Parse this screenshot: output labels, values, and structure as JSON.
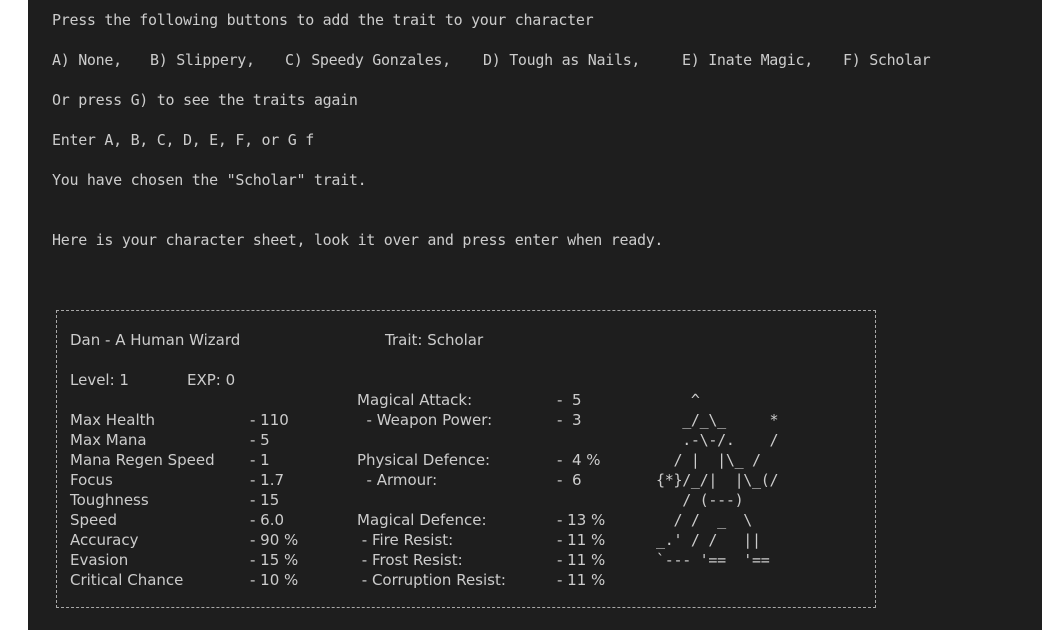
{
  "prompt": {
    "line1": "Press the following buttons to add the trait to your character",
    "options": [
      "A) None,",
      "B) Slippery,",
      "C) Speedy Gonzales,",
      "D) Tough as Nails,",
      "E) Inate Magic,",
      "F) Scholar"
    ],
    "line3": "Or press G) to see the traits again",
    "line4": "Enter A, B, C, D, E, F, or G f",
    "line5": "You have chosen the \"Scholar\" trait.",
    "line6": "Here is your character sheet, look it over and press enter when ready."
  },
  "sheet": {
    "name": "Dan - A Human Wizard",
    "trait": "Trait: Scholar",
    "level": "Level: 1",
    "exp": "EXP: 0",
    "stats": [
      {
        "label": "Max Health",
        "value": "- 110"
      },
      {
        "label": "Max Mana",
        "value": "- 5"
      },
      {
        "label": "Mana Regen Speed",
        "value": "- 1"
      },
      {
        "label": "Focus",
        "value": "- 1.7"
      },
      {
        "label": "Toughness",
        "value": "- 15"
      },
      {
        "label": "Speed",
        "value": "- 6.0"
      },
      {
        "label": "Accuracy",
        "value": "- 90 %"
      },
      {
        "label": "Evasion",
        "value": "- 15 %"
      },
      {
        "label": "Critical Chance",
        "value": "- 10 %"
      }
    ],
    "magic": [
      {
        "label": "Magical Attack:",
        "value": "-  5"
      },
      {
        "label": "  - Weapon Power:",
        "value": "-  3"
      },
      {
        "label": "",
        "value": ""
      },
      {
        "label": "Physical Defence:",
        "value": "-  4 %"
      },
      {
        "label": "  - Armour:",
        "value": "-  6"
      },
      {
        "label": "",
        "value": ""
      },
      {
        "label": "Magical Defence:",
        "value": "- 13 %"
      },
      {
        "label": " - Fire Resist:",
        "value": "- 11 %"
      },
      {
        "label": " - Frost Resist:",
        "value": "- 11 %"
      },
      {
        "label": " - Corruption Resist:",
        "value": "- 11 %"
      }
    ],
    "art": [
      "    ^",
      "   _/_\\_     *",
      "   .-\\-/.    /",
      "  / |  |\\_ /",
      "{*}/_/|  |\\_(/",
      "   / (---)",
      "  / /  _  \\",
      "_.' / /   ||",
      "`--- '==  '=="
    ]
  }
}
